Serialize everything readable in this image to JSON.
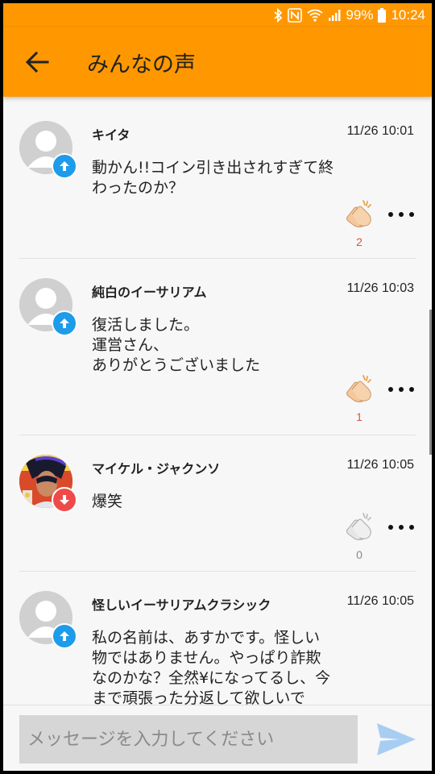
{
  "status_bar": {
    "battery": "99%",
    "time": "10:24",
    "icons": [
      "bluetooth-icon",
      "nfc-icon",
      "wifi-icon",
      "signal-icon",
      "battery-icon"
    ]
  },
  "app_bar": {
    "title": "みんなの声",
    "background_color": "#ff9800"
  },
  "posts": [
    {
      "user": "キイタ",
      "time": "11/26 10:01",
      "message": "動かん!!コイン引き出されすぎて終\nわったのか？",
      "vote": "up",
      "claps": "2",
      "avatar": "default"
    },
    {
      "user": "純白のイーサリアム",
      "time": "11/26 10:03",
      "message": "復活しました。\n運営さん、\nありがとうございました",
      "vote": "up",
      "claps": "1",
      "avatar": "default"
    },
    {
      "user": "マイケル・ジャクンソ",
      "time": "11/26 10:05",
      "message": "爆笑",
      "vote": "down",
      "claps": "0",
      "avatar": "photo"
    },
    {
      "user": "怪しいイーサリアムクラシック",
      "time": "11/26 10:05",
      "message": "私の名前は、あすかです。怪しい\n物ではありません。やっぱり詐欺\nなのかな？全然¥になってるし、今\nまで頑張った分返して欲しいで",
      "vote": "up",
      "claps": "",
      "avatar": "default"
    }
  ],
  "composer": {
    "placeholder": "メッセージを入力してください"
  },
  "colors": {
    "up_badge": "#1e9be9",
    "down_badge": "#ef4a4a",
    "clap_count": "#d9534f",
    "clap_count_zero": "#888888",
    "send_arrow": "#a8cdf3"
  }
}
